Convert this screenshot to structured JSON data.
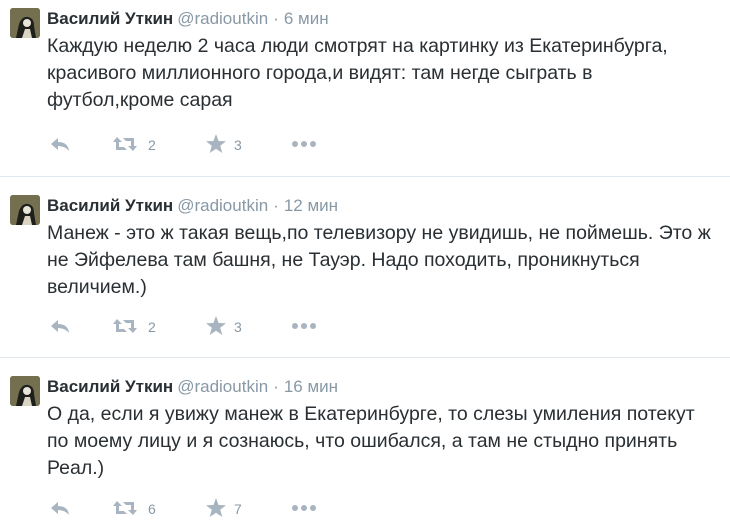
{
  "tweets": [
    {
      "name": "Василий Уткин",
      "handle": "@radioutkin",
      "separator": "·",
      "time": "6 мин",
      "lines": [
        "Каждую неделю 2 часа люди смотрят на картинку из Екатеринбурга,",
        "красивого миллионного города,и видят: там негде сыграть в",
        "футбол,кроме сарая"
      ],
      "retweets": "2",
      "favorites": "3"
    },
    {
      "name": "Василий Уткин",
      "handle": "@radioutkin",
      "separator": "·",
      "time": "12 мин",
      "lines": [
        "Манеж - это ж такая вещь,по телевизору не увидишь, не поймешь. Это ж",
        "не Эйфелева там башня, не Тауэр. Надо походить, проникнуться",
        "величием.)"
      ],
      "retweets": "2",
      "favorites": "3"
    },
    {
      "name": "Василий Уткин",
      "handle": "@radioutkin",
      "separator": "·",
      "time": "16 мин",
      "lines": [
        "О да, если я увижу манеж в Екатеринбурге, то слезы умиления потекут",
        "по моему лицу и я сознаюсь, что ошибался, а там не стыдно принять",
        "Реал.)"
      ],
      "retweets": "6",
      "favorites": "7"
    }
  ],
  "icons": {
    "reply": "reply-icon",
    "retweet": "retweet-icon",
    "favorite": "star-icon",
    "more": "more-icon"
  },
  "colors": {
    "icon": "#a8b4bf",
    "meta": "#8899a6",
    "text": "#292f33",
    "divider": "#e1e8ed"
  }
}
